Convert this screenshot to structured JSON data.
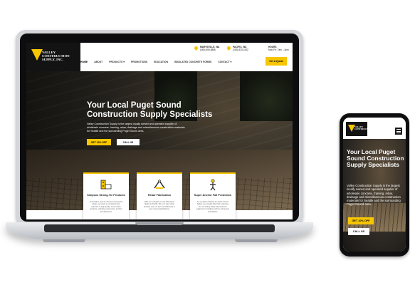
{
  "site": {
    "logo_lines": [
      "VALLEY",
      "CONSTRUCTION",
      "SUPPLY, INC."
    ],
    "locations": [
      {
        "city": "MARYSVILLE, WA",
        "phone": "(360) 659-8886"
      },
      {
        "city": "PACIFIC, WA",
        "phone": "(253) 833-1532"
      }
    ],
    "hours_label": "HOURS",
    "hours_value": "Mon-Fri: 7am – 4pm",
    "nav": [
      "HOME",
      "ABOUT",
      "PRODUCTS",
      "PROMOTIONS",
      "EDUCATION",
      "INSULATED CONCRETE FORMS",
      "CONTACT"
    ],
    "quote_button": "Get A Quote",
    "hero_title": "Your Local Puget Sound Construction Supply Specialists",
    "hero_text": "Valley Construction Supply is the largest locally owned and operated supplier of wholesale concrete, framing, rebar, drainage and miscellaneous construction materials for Seattle and the surrounding Puget Sound area.",
    "cta_primary": "GET 10% OFF",
    "cta_secondary": "CALL US",
    "cards": [
      {
        "title": "Simpson Strong-Tie Products",
        "text": "As Seattle's premier Simpson Strong-Tie dealer, we stock a comprehensive selection of high-quality construction products, including connectors, anchors and adhesives."
      },
      {
        "title": "Rebar Fabrication",
        "text": "With our complete on-site fabrication facility in Pacific, WA, our steel rebar benders can cut, bend and fabricate to your exact specifications."
      },
      {
        "title": "Super Anchor Fall Protection",
        "text": "As a preferred dealer for Super Anchor Safety, we proudly offer their extensive line of roofing safety fall protection equipment including anchors, harnesses and ladders."
      }
    ]
  },
  "colors": {
    "accent": "#f7c600",
    "dark": "#131313"
  }
}
